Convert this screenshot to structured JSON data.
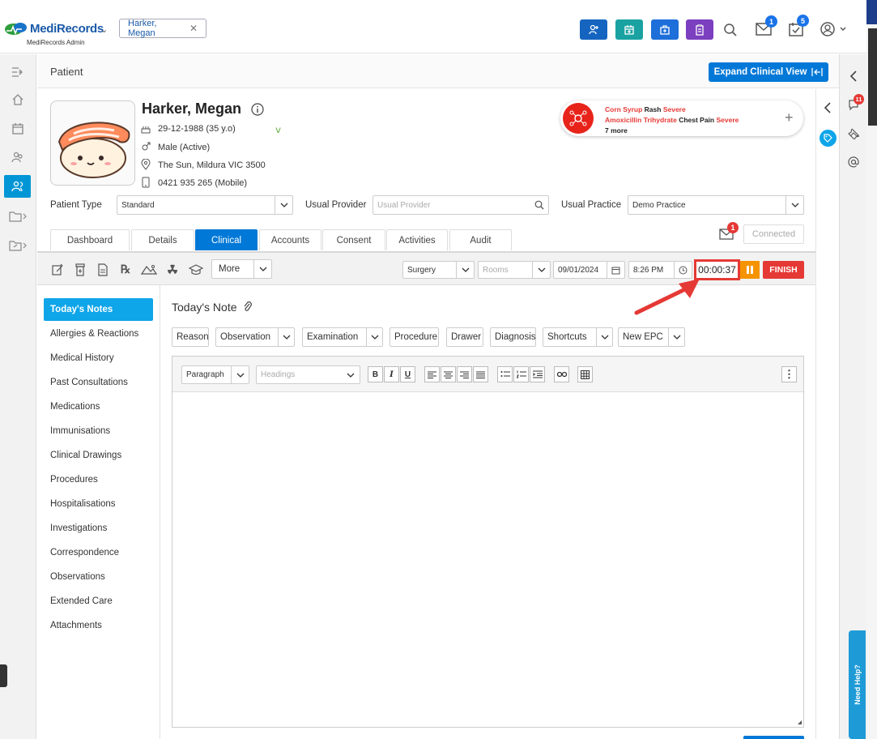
{
  "brand": {
    "name": "MediRecords",
    "subtitle": "MediRecords Admin"
  },
  "open_patient_chip": "Harker, Megan",
  "header": {
    "mail_badge": "1",
    "tasks_badge": "5"
  },
  "page_title": "Patient",
  "expand_button": "Expand Clinical View",
  "patient": {
    "name": "Harker, Megan",
    "dob": "29-12-1988 (35 y.o)",
    "gender": "Male (Active)",
    "address": "The Sun, Mildura VIC 3500",
    "phone": "0421 935 265 (Mobile)"
  },
  "allergies": {
    "items": [
      {
        "substance": "Corn Syrup",
        "reaction": "Rash",
        "severity": "Severe"
      },
      {
        "substance": "Amoxicillin Trihydrate",
        "reaction": "Chest Pain",
        "severity": "Severe"
      }
    ],
    "more": "7 more"
  },
  "fields": {
    "patient_type_label": "Patient Type",
    "patient_type_value": "Standard",
    "usual_provider_label": "Usual Provider",
    "usual_provider_placeholder": "Usual Provider",
    "usual_practice_label": "Usual Practice",
    "usual_practice_value": "Demo Practice"
  },
  "tabs": [
    {
      "label": "Dashboard"
    },
    {
      "label": "Details"
    },
    {
      "label": "Clinical"
    },
    {
      "label": "Accounts"
    },
    {
      "label": "Consent"
    },
    {
      "label": "Activities"
    },
    {
      "label": "Audit"
    }
  ],
  "messages_badge": "1",
  "connected_label": "Connected",
  "toolbar": {
    "more_label": "More",
    "surgery_value": "Surgery",
    "rooms_placeholder": "Rooms",
    "date_value": "09/01/2024",
    "time_value": "8:26 PM",
    "timer_value": "00:00:37",
    "finish_label": "FINISH"
  },
  "side_items": [
    {
      "label": "Today's Notes"
    },
    {
      "label": "Allergies & Reactions"
    },
    {
      "label": "Medical History"
    },
    {
      "label": "Past Consultations"
    },
    {
      "label": "Medications"
    },
    {
      "label": "Immunisations"
    },
    {
      "label": "Clinical Drawings"
    },
    {
      "label": "Procedures"
    },
    {
      "label": "Hospitalisations"
    },
    {
      "label": "Investigations"
    },
    {
      "label": "Correspondence"
    },
    {
      "label": "Observations"
    },
    {
      "label": "Extended Care"
    },
    {
      "label": "Attachments"
    }
  ],
  "note": {
    "title": "Today's Note",
    "buttons": {
      "reason": "Reason",
      "observation": "Observation",
      "examination": "Examination",
      "procedure": "Procedure",
      "drawer": "Drawer",
      "diagnosis": "Diagnosis",
      "shortcuts": "Shortcuts",
      "new_epc": "New EPC"
    },
    "editor": {
      "paragraph": "Paragraph",
      "headings_placeholder": "Headings"
    }
  },
  "right_panel": {
    "notification_badge": "11",
    "need_help": "Need Help?"
  },
  "colors": {
    "primary": "#0078d7",
    "active_side": "#0ea5e9",
    "finish": "#e53935",
    "pause": "#f59300",
    "highlight_box": "#e53935",
    "brand_green": "#2e9e3e",
    "brand_blue": "#1a5aa8"
  }
}
